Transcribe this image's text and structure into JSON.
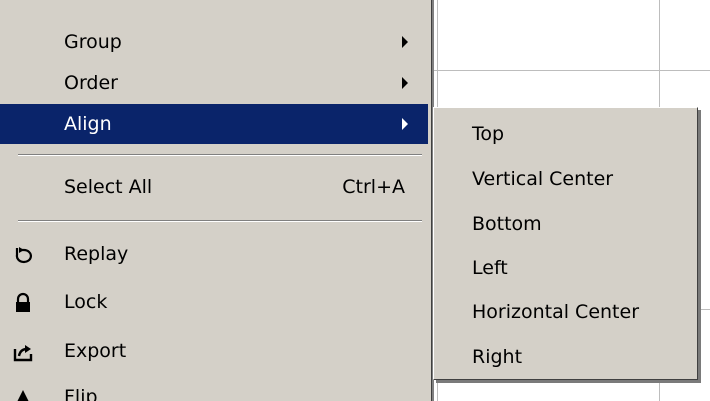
{
  "menu": {
    "items": [
      {
        "label": "Group",
        "submenu": true
      },
      {
        "label": "Order",
        "submenu": true
      },
      {
        "label": "Align",
        "submenu": true,
        "selected": true
      },
      {
        "label": "Select All",
        "shortcut": "Ctrl+A"
      },
      {
        "label": "Replay",
        "icon": "replay-icon"
      },
      {
        "label": "Lock",
        "icon": "lock-icon"
      },
      {
        "label": "Export",
        "icon": "export-icon"
      },
      {
        "label": "Flip",
        "icon": "flip-icon"
      }
    ]
  },
  "submenu": {
    "parent": "Align",
    "items": [
      {
        "label": "Top"
      },
      {
        "label": "Vertical Center"
      },
      {
        "label": "Bottom"
      },
      {
        "label": "Left"
      },
      {
        "label": "Horizontal Center"
      },
      {
        "label": "Right"
      }
    ]
  },
  "colors": {
    "menu_bg": "#d4d0c8",
    "highlight": "#0a246a",
    "highlight_text": "#ffffff"
  }
}
